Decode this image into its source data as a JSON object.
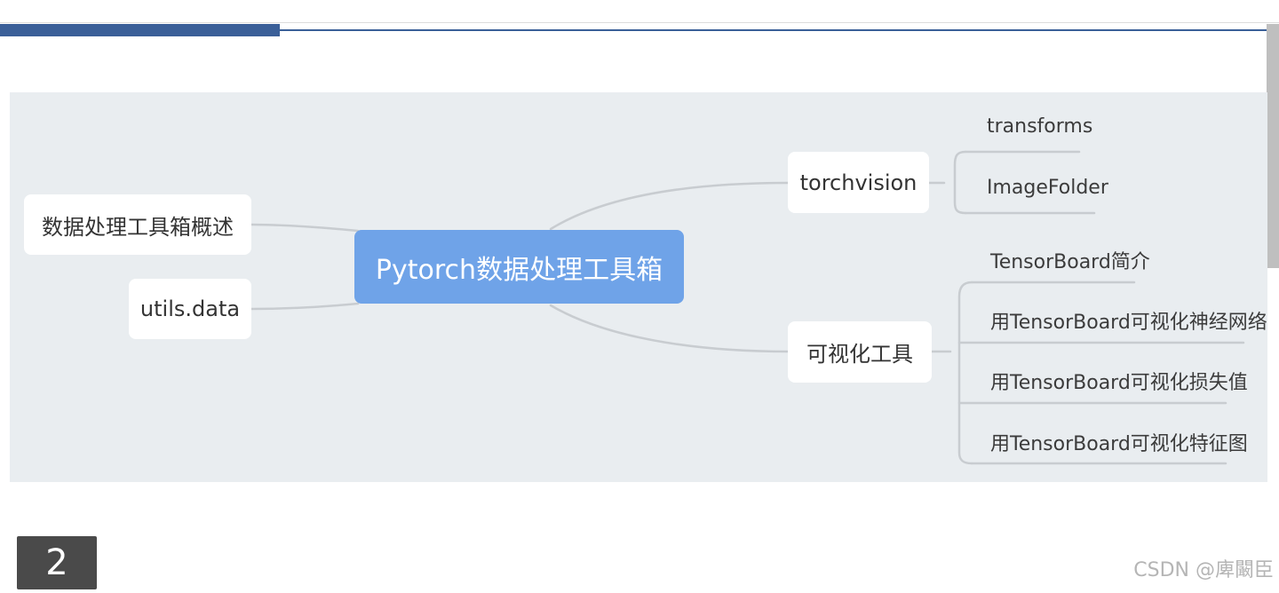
{
  "page_number": "2",
  "watermark": "CSDN @庳闞臣",
  "mindmap": {
    "root": "Pytorch数据处理工具箱",
    "left_nodes": [
      "数据处理工具箱概述",
      "utils.data"
    ],
    "right_nodes": [
      {
        "label": "torchvision",
        "children": [
          "transforms",
          "ImageFolder"
        ]
      },
      {
        "label": "可视化工具",
        "children": [
          "TensorBoard简介",
          "用TensorBoard可视化神经网络",
          "用TensorBoard可视化损失值",
          "用TensorBoard可视化特征图"
        ]
      }
    ]
  },
  "colors": {
    "accent_bar": "#3a5f98",
    "canvas_bg": "#e9edf0",
    "root_bg": "#6fa3e8",
    "connector": "#c8ccd0"
  }
}
